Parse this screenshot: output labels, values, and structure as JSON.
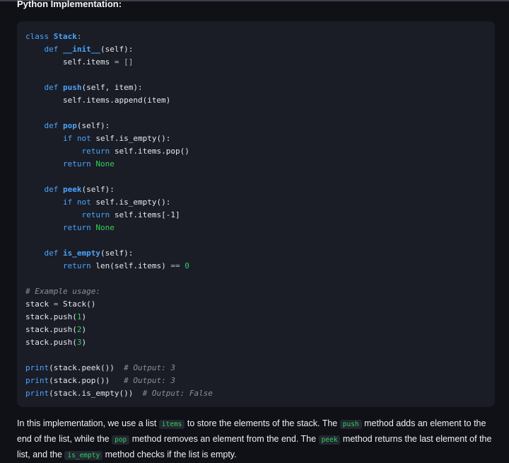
{
  "heading": "Python Implementation:",
  "code": {
    "l1_kw": "class",
    "l1_name": "Stack",
    "l1_punct": ":",
    "init_def": "def",
    "init_name": "__init__",
    "init_args": "(self):",
    "init_body_a": "self.items",
    "init_body_op": "=",
    "init_body_b": "[]",
    "push_def": "def",
    "push_name": "push",
    "push_args": "(self, item):",
    "push_body": "self.items.append(item)",
    "pop_def": "def",
    "pop_name": "pop",
    "pop_args": "(self):",
    "pop_if_kw": "if not",
    "pop_if_rest": "self.is_empty():",
    "pop_ret_kw": "return",
    "pop_ret_rest": "self.items.pop()",
    "pop_ret2_kw": "return",
    "pop_ret2_val": "None",
    "peek_def": "def",
    "peek_name": "peek",
    "peek_args": "(self):",
    "peek_if_kw": "if not",
    "peek_if_rest": "self.is_empty():",
    "peek_ret_kw": "return",
    "peek_ret_rest": "self.items[-1]",
    "peek_ret2_kw": "return",
    "peek_ret2_val": "None",
    "empty_def": "def",
    "empty_name": "is_empty",
    "empty_args": "(self):",
    "empty_ret_kw": "return",
    "empty_ret_rest": "len(self.items)",
    "empty_op": "==",
    "empty_num": "0",
    "comment_usage": "# Example usage:",
    "u1_a": "stack",
    "u1_op": "=",
    "u1_b": "Stack()",
    "u2_a": "stack.push(",
    "u2_n": "1",
    "u2_b": ")",
    "u3_a": "stack.push(",
    "u3_n": "2",
    "u3_b": ")",
    "u4_a": "stack.push(",
    "u4_n": "3",
    "u4_b": ")",
    "p1_kw": "print",
    "p1_rest": "(stack.peek())",
    "p1_cm": "# Output: 3",
    "p2_kw": "print",
    "p2_rest": "(stack.pop())",
    "p2_cm": "# Output: 3",
    "p3_kw": "print",
    "p3_rest": "(stack.is_empty())",
    "p3_cm": "# Output: False"
  },
  "prose": {
    "t1": "In this implementation, we use a list ",
    "c1": "items",
    "t2": " to store the elements of the stack. The ",
    "c2": "push",
    "t3": " method adds an element to the end of the list, while the ",
    "c3": "pop",
    "t4": " method removes an element from the end. The ",
    "c4": "peek",
    "t5": " method returns the last element of the list, and the ",
    "c5": "is_empty",
    "t6": " method checks if the list is empty."
  },
  "colors": {
    "background": "#0f1117",
    "code_background": "#1a1d26",
    "keyword": "#4aa3ff",
    "literal": "#2fd05a",
    "comment": "#8a8f9a"
  }
}
